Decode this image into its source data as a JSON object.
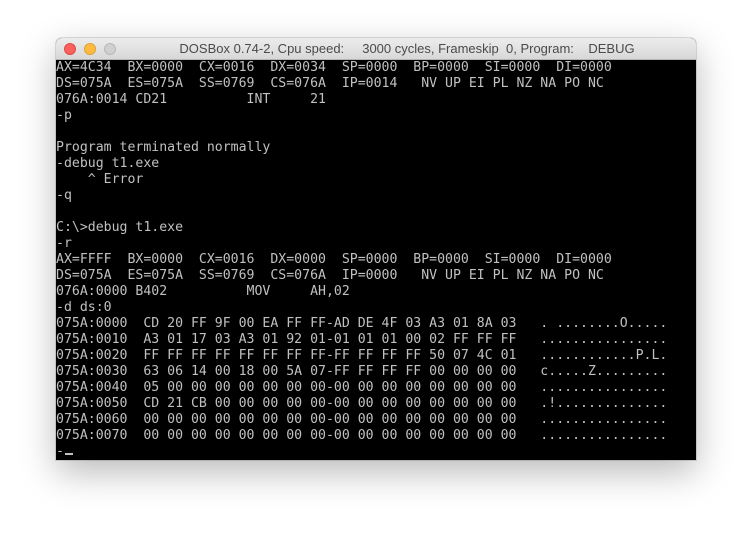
{
  "window": {
    "title": "DOSBox 0.74-2, Cpu speed:     3000 cycles, Frameskip  0, Program:    DEBUG",
    "close_icon": "close-icon",
    "minimize_icon": "minimize-icon",
    "zoom_icon": "zoom-icon"
  },
  "colors": {
    "terminal_bg": "#000000",
    "terminal_fg": "#c0c0c0",
    "close": "#fc605c",
    "minimize": "#fdbc40",
    "zoom": "#d0d0d0"
  },
  "terminal": {
    "lines": [
      "AX=4C34  BX=0000  CX=0016  DX=0034  SP=0000  BP=0000  SI=0000  DI=0000",
      "DS=075A  ES=075A  SS=0769  CS=076A  IP=0014   NV UP EI PL NZ NA PO NC",
      "076A:0014 CD21          INT     21",
      "-p",
      "",
      "Program terminated normally",
      "-debug t1.exe",
      "    ^ Error",
      "-q",
      "",
      "C:\\>debug t1.exe",
      "-r",
      "AX=FFFF  BX=0000  CX=0016  DX=0000  SP=0000  BP=0000  SI=0000  DI=0000",
      "DS=075A  ES=075A  SS=0769  CS=076A  IP=0000   NV UP EI PL NZ NA PO NC",
      "076A:0000 B402          MOV     AH,02",
      "-d ds:0",
      "075A:0000  CD 20 FF 9F 00 EA FF FF-AD DE 4F 03 A3 01 8A 03   . ........O.....",
      "075A:0010  A3 01 17 03 A3 01 92 01-01 01 01 00 02 FF FF FF   ................",
      "075A:0020  FF FF FF FF FF FF FF FF-FF FF FF FF 50 07 4C 01   ............P.L.",
      "075A:0030  63 06 14 00 18 00 5A 07-FF FF FF FF 00 00 00 00   c.....Z.........",
      "075A:0040  05 00 00 00 00 00 00 00-00 00 00 00 00 00 00 00   ................",
      "075A:0050  CD 21 CB 00 00 00 00 00-00 00 00 00 00 00 00 00   .!..............",
      "075A:0060  00 00 00 00 00 00 00 00-00 00 00 00 00 00 00 00   ................",
      "075A:0070  00 00 00 00 00 00 00 00-00 00 00 00 00 00 00 00   ................",
      "-"
    ]
  }
}
